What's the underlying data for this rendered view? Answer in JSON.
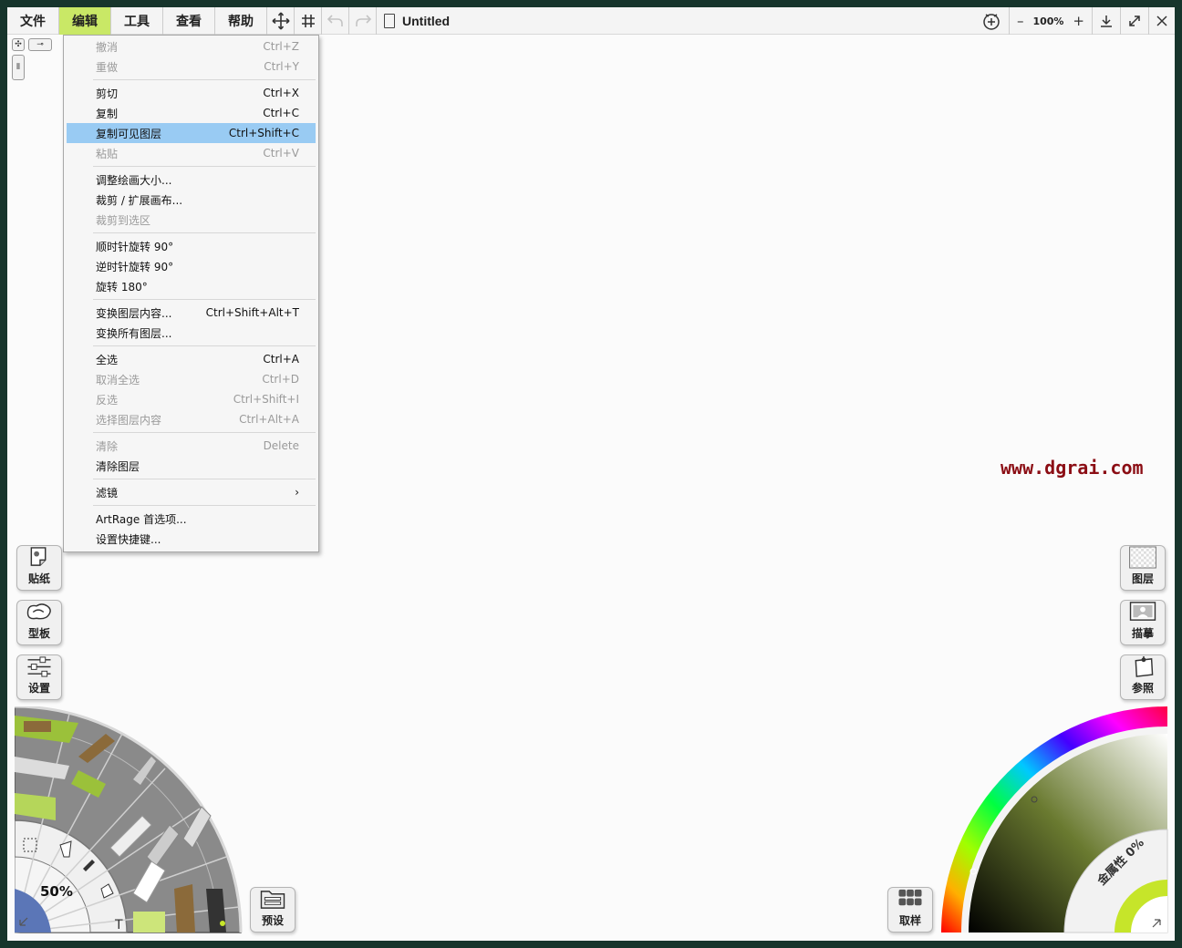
{
  "menubar": {
    "items": [
      "文件",
      "编辑",
      "工具",
      "查看",
      "帮助"
    ],
    "active_index": 1,
    "document_title": "Untitled",
    "zoom": "100%",
    "zoom_out": "–",
    "zoom_in": "+"
  },
  "edit_menu": {
    "groups": [
      [
        {
          "label": "撤消",
          "shortcut": "Ctrl+Z",
          "disabled": true
        },
        {
          "label": "重做",
          "shortcut": "Ctrl+Y",
          "disabled": true
        }
      ],
      [
        {
          "label": "剪切",
          "shortcut": "Ctrl+X",
          "disabled": false
        },
        {
          "label": "复制",
          "shortcut": "Ctrl+C",
          "disabled": false
        },
        {
          "label": "复制可见图层",
          "shortcut": "Ctrl+Shift+C",
          "disabled": false,
          "highlight": true
        },
        {
          "label": "粘贴",
          "shortcut": "Ctrl+V",
          "disabled": true
        }
      ],
      [
        {
          "label": "调整绘画大小...",
          "shortcut": "",
          "disabled": false
        },
        {
          "label": "裁剪 / 扩展画布...",
          "shortcut": "",
          "disabled": false
        },
        {
          "label": "裁剪到选区",
          "shortcut": "",
          "disabled": true
        }
      ],
      [
        {
          "label": "顺时针旋转 90°",
          "shortcut": "",
          "disabled": false
        },
        {
          "label": "逆时针旋转 90°",
          "shortcut": "",
          "disabled": false
        },
        {
          "label": "旋转 180°",
          "shortcut": "",
          "disabled": false
        }
      ],
      [
        {
          "label": "变换图层内容...",
          "shortcut": "Ctrl+Shift+Alt+T",
          "disabled": false
        },
        {
          "label": "变换所有图层...",
          "shortcut": "",
          "disabled": false
        }
      ],
      [
        {
          "label": "全选",
          "shortcut": "Ctrl+A",
          "disabled": false
        },
        {
          "label": "取消全选",
          "shortcut": "Ctrl+D",
          "disabled": true
        },
        {
          "label": "反选",
          "shortcut": "Ctrl+Shift+I",
          "disabled": true
        },
        {
          "label": "选择图层内容",
          "shortcut": "Ctrl+Alt+A",
          "disabled": true
        }
      ],
      [
        {
          "label": "清除",
          "shortcut": "Delete",
          "disabled": true
        },
        {
          "label": "清除图层",
          "shortcut": "",
          "disabled": false
        }
      ],
      [
        {
          "label": "滤镜",
          "shortcut": "›",
          "disabled": false
        }
      ],
      [
        {
          "label": "ArtRage 首选项...",
          "shortcut": "",
          "disabled": false
        },
        {
          "label": "设置快捷键...",
          "shortcut": "",
          "disabled": false
        }
      ]
    ]
  },
  "watermark": "www.dgrai.com",
  "left_panels": {
    "stickers": "贴纸",
    "stencils": "型板",
    "settings": "设置",
    "presets": "预设"
  },
  "right_panels": {
    "layers": "图层",
    "tracing": "描摹",
    "references": "参照",
    "sample": "取样"
  },
  "tool_wheel": {
    "brush_size": "50%"
  },
  "color_picker": {
    "metallic": "金属性 0%",
    "accent_color": "#c6e52a"
  }
}
